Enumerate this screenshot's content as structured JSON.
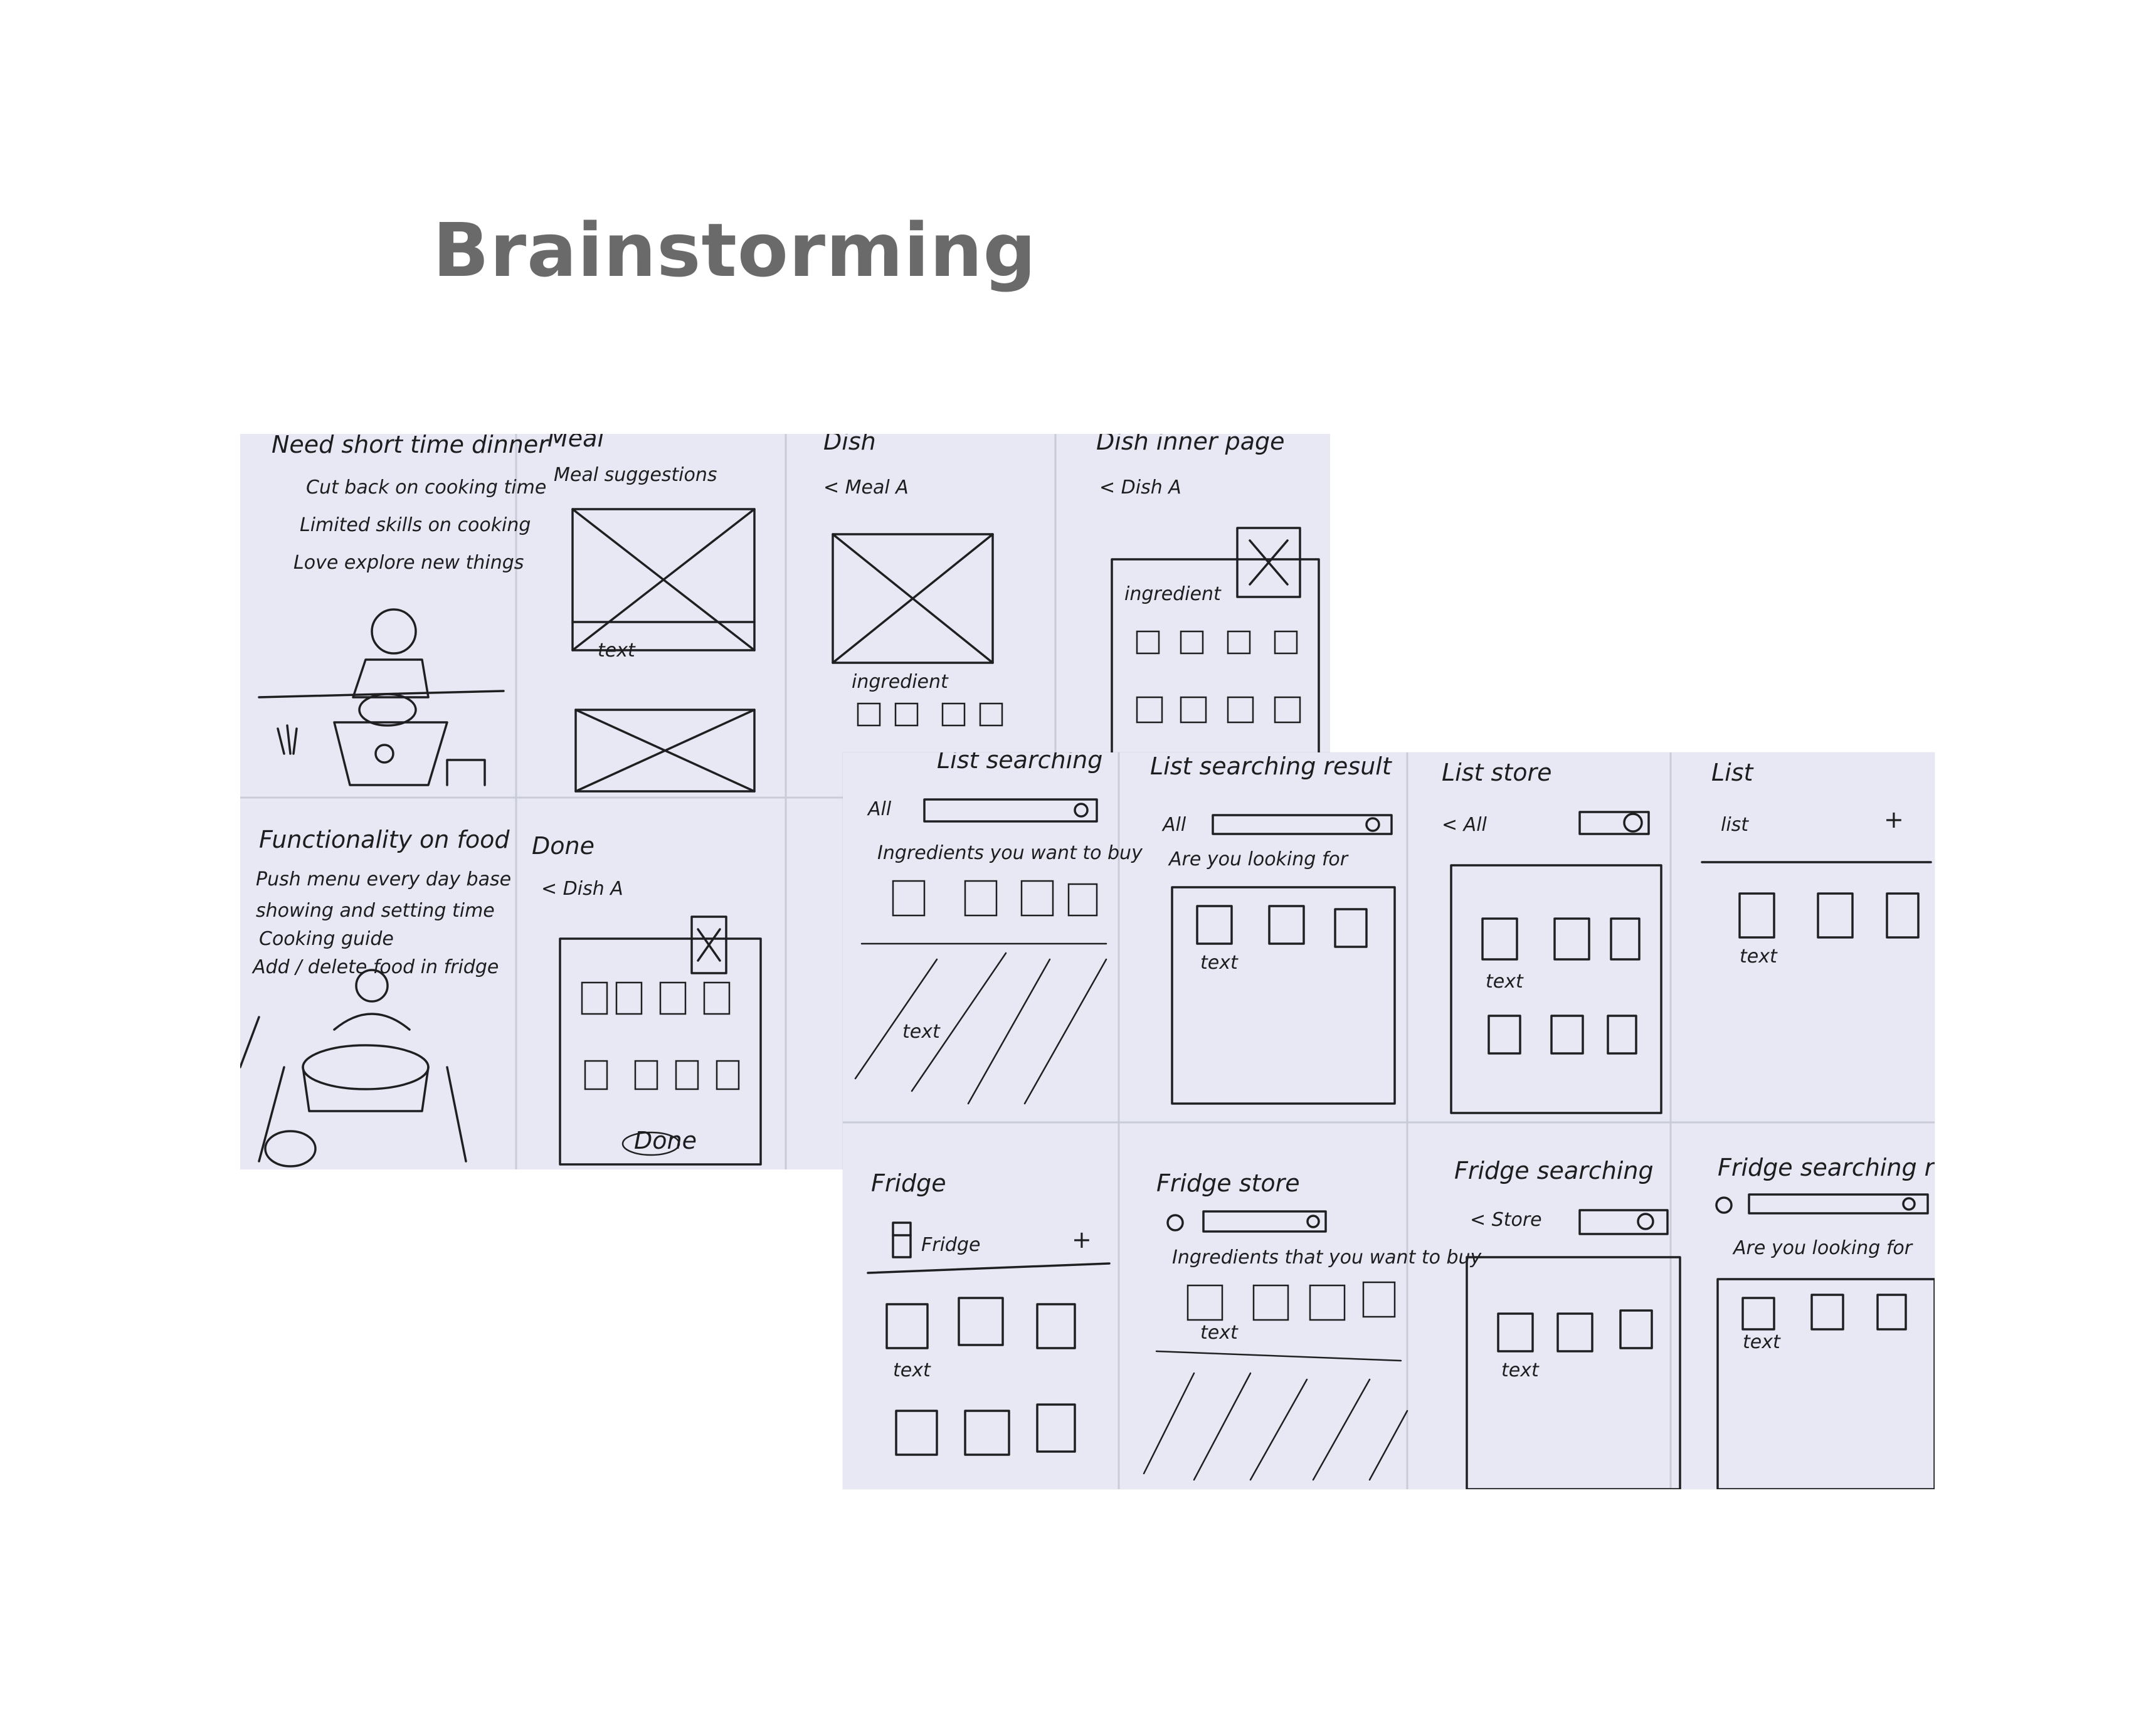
{
  "page": {
    "title": "Brainstorming"
  },
  "sketch_sheet_1": {
    "panels": [
      {
        "heading": "Need short time dinner",
        "notes": [
          "Cut back on cooking time",
          "Limited skills on cooking",
          "Love explore new things"
        ]
      },
      {
        "heading": "Meal",
        "notes": [
          "Meal suggestions",
          "text"
        ]
      },
      {
        "heading": "Dish",
        "notes": [
          "< Meal A",
          "ingredient"
        ]
      },
      {
        "heading": "Dish inner page",
        "notes": [
          "< Dish A",
          "ingredient"
        ]
      },
      {
        "heading": "Functionality on food",
        "notes": [
          "Push menu every day base",
          "showing and setting time",
          "Cooking guide",
          "Add / delete food in fridge"
        ]
      },
      {
        "heading": "Done",
        "notes": [
          "< Dish A",
          "Done"
        ]
      }
    ]
  },
  "sketch_sheet_2": {
    "panels": [
      {
        "heading": "List searching",
        "notes": [
          "All",
          "Ingredients you want to buy",
          "text"
        ]
      },
      {
        "heading": "List searching result",
        "notes": [
          "All",
          "Are you looking for",
          "text"
        ]
      },
      {
        "heading": "List store",
        "notes": [
          "< All",
          "text"
        ]
      },
      {
        "heading": "List",
        "notes": [
          "list",
          "+",
          "text"
        ]
      },
      {
        "heading": "Fridge",
        "notes": [
          "Fridge",
          "+",
          "text"
        ]
      },
      {
        "heading": "Fridge store",
        "notes": [
          "Ingredients that you want to buy",
          "text"
        ]
      },
      {
        "heading": "Fridge searching",
        "notes": [
          "< Store",
          "text"
        ]
      },
      {
        "heading": "Fridge searching result",
        "notes": [
          "Are you looking for",
          "text"
        ]
      }
    ]
  },
  "colors": {
    "paper": "#e7e8f3",
    "ink": "#1f1f22",
    "title": "#6a6a6a"
  }
}
